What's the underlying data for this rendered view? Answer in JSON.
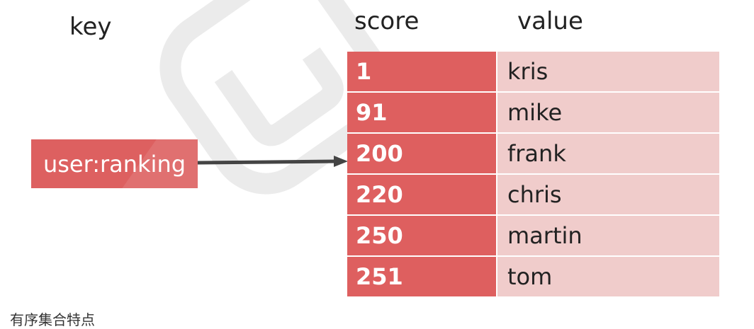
{
  "headers": {
    "key": "key",
    "score": "score",
    "value": "value"
  },
  "key_name": "user:ranking",
  "rows": [
    {
      "score": "1",
      "value": "kris"
    },
    {
      "score": "91",
      "value": "mike"
    },
    {
      "score": "200",
      "value": "frank"
    },
    {
      "score": "220",
      "value": "chris"
    },
    {
      "score": "250",
      "value": "martin"
    },
    {
      "score": "251",
      "value": "tom"
    }
  ],
  "footer_text": "有序集合特点",
  "colors": {
    "score_bg": "#de5f5f",
    "value_bg": "#f0cccb",
    "key_bg": "#dd6060",
    "arrow": "#444444"
  }
}
